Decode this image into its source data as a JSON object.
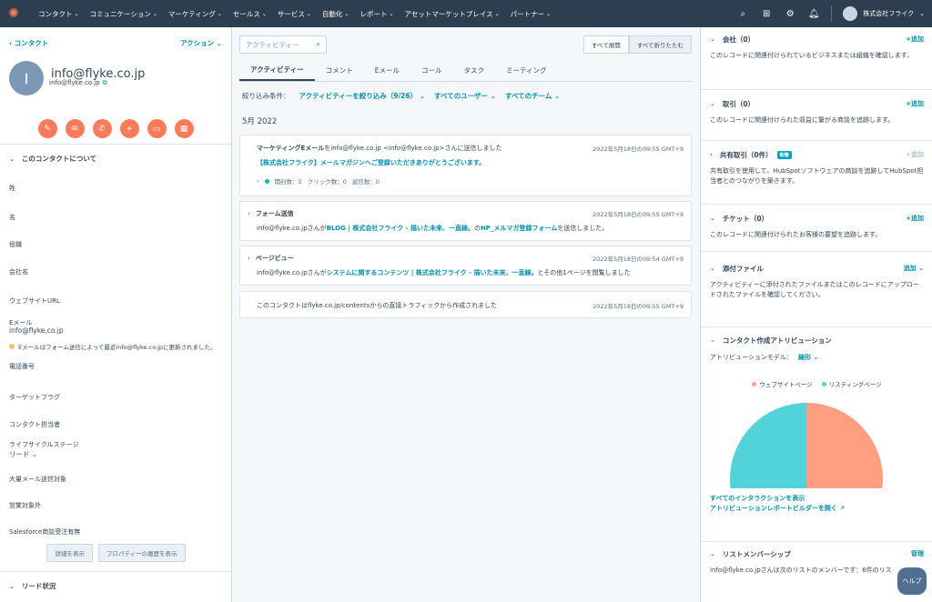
{
  "nav": {
    "items": [
      "コンタクト",
      "コミュニケーション",
      "マーケティング",
      "セールス",
      "サービス",
      "自動化",
      "レポート",
      "アセットマーケットプレイス",
      "パートナー"
    ],
    "account": "株式会社フライク"
  },
  "left": {
    "back": "コンタクト",
    "actions": "アクション",
    "avatar_letter": "I",
    "name": "info@flyke.co.jp",
    "email": "info@flyke.co.jp",
    "about_title": "このコンタクトについて",
    "props": {
      "last_name": "姓",
      "first_name": "名",
      "job_title": "役職",
      "company": "会社名",
      "website": "ウェブサイトURL",
      "email_label": "Eメール",
      "email_value": "info@flyke.co.jp",
      "email_note": "Eメールはフォーム送信によって最近info@flyke.co.jpに更新されました。",
      "phone": "電話番号",
      "target_flag": "ターゲットフラグ",
      "owner": "コンタクト担当者",
      "lifecycle": "ライフサイクルステージ",
      "lifecycle_value": "リード",
      "bulk_mail": "大量メール送信対象",
      "sales_excluded": "営業対象外",
      "salesforce": "Salesforce商談受注有無"
    },
    "show_details": "詳細を表示",
    "property_history": "プロパティーの履歴を表示",
    "lead_status": "リード状況"
  },
  "center": {
    "search_placeholder": "アクティビティー",
    "expand_all": "すべて展開",
    "collapse_all": "すべて折りたたむ",
    "tabs": [
      "アクティビティー",
      "コメント",
      "Eメール",
      "コール",
      "タスク",
      "ミーティング"
    ],
    "filter_label": "絞り込み条件：",
    "filter_activity": "アクティビティーを絞り込み（9/26）",
    "filter_users": "すべてのユーザー",
    "filter_teams": "すべてのチーム",
    "month": "5月 2022",
    "cards": {
      "email": {
        "title_bold": "マーケティングEメール",
        "title_rest": "をinfo@flyke.co.jp <info@flyke.co.jp>さんに送信しました",
        "time": "2022年5月18日の09:55 GMT+9",
        "subject": "【株式会社フライク】メールマガジンへご登録いただきありがとうございます。",
        "opens": "開封数：5",
        "clicks": "クリック数：0",
        "replies": "返信数：0"
      },
      "form": {
        "title": "フォーム送信",
        "time": "2022年5月18日の09:55 GMT+9",
        "pre": "info@flyke.co.jpさんが",
        "link1": "BLOG | 株式会社フライク - 描いた未来、一直線。",
        "mid": "の",
        "link2": "HP_メルマガ登録フォーム",
        "post": "を送信しました。"
      },
      "pageview": {
        "title": "ページビュー",
        "time": "2022年5月18日の09:54 GMT+9",
        "pre": "info@flyke.co.jpさんが",
        "link": "システムに関するコンテンツ | 株式会社フライク - 描いた未来、一直線。",
        "post": "とその他1ページを閲覧しました"
      },
      "created": {
        "text": "このコンタクトはflyke.co.jp/contentsからの直接トラフィックから作成されました",
        "time": "2022年5月18日の09:55 GMT+9"
      }
    }
  },
  "right": {
    "company": {
      "title": "会社（0）",
      "add": "+追加",
      "text": "このレコードに関連付けられているビジネスまたは組織を確認します。"
    },
    "deals": {
      "title": "取引（0）",
      "add": "+追加",
      "text": "このレコードに関連付けられた収益に繋がる商談を追跡します。"
    },
    "shared_deals": {
      "title": "共有取引（0件）",
      "badge": "新機",
      "add": "+追加",
      "text": "共有取引を使用して、HubSpotソフトウェアの商談を追跡してHubSpot担当者とのつながりを築きます。"
    },
    "tickets": {
      "title": "チケット（0）",
      "add": "+追加",
      "text": "このレコードに関連付けられたお客様の要望を追跡します。"
    },
    "attachments": {
      "title": "添付ファイル",
      "add": "追加",
      "text": "アクティビティーに添付されたファイルまたはこのレコードにアップロードされたファイルを確認してください。"
    },
    "attribution": {
      "title": "コンタクト作成アトリビューション",
      "model_label": "アトリビューションモデル：",
      "model_value": "線形",
      "link1": "すべてのインタラクションを表示",
      "link2": "アトリビューションレポートビルダーを開く"
    },
    "lists": {
      "title": "リストメンバーシップ",
      "manage": "管理",
      "text": "info@flyke.co.jpさんは次のリストのメンバーです：6件のリス"
    }
  },
  "help": "ヘルプ",
  "colors": {
    "accent": "#ff7a59",
    "link": "#0091ae",
    "nav": "#2d3e50"
  },
  "chart_data": {
    "type": "pie",
    "categories": [
      "ウェブサイトページ",
      "リスティングページ"
    ],
    "values": [
      50,
      50
    ],
    "colors": [
      "#ff9e80",
      "#51d3d9"
    ],
    "title": "",
    "legend": "top"
  }
}
